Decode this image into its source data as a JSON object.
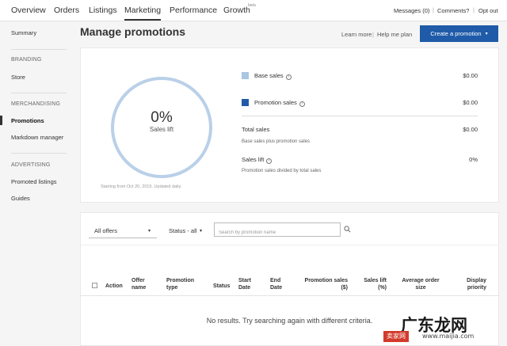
{
  "nav": {
    "tabs": [
      "Overview",
      "Orders",
      "Listings",
      "Marketing",
      "Performance",
      "Growth"
    ],
    "active_tab": "Marketing",
    "growth_badge": "beta",
    "messages": "Messages (0)",
    "comments": "Comments?",
    "opt_out": "Opt out"
  },
  "sidebar": {
    "summary": "Summary",
    "branding_heading": "BRANDING",
    "store": "Store",
    "merchandising_heading": "MERCHANDISING",
    "promotions": "Promotions",
    "markdown_manager": "Markdown manager",
    "advertising_heading": "ADVERTISING",
    "promoted_listings": "Promoted listings",
    "guides": "Guides"
  },
  "header": {
    "title": "Manage promotions",
    "learn_more": "Learn more",
    "help_me_plan": "Help me plan",
    "create_button": "Create a promotion"
  },
  "summary": {
    "ring_value": "0%",
    "ring_label": "Sales lift",
    "starting_note": "Starting from Oct 20, 2015. Updated daily.",
    "base_sales_label": "Base sales",
    "base_sales_value": "$0.00",
    "promotion_sales_label": "Promotion sales",
    "promotion_sales_value": "$0.00",
    "total_sales_label": "Total sales",
    "total_sales_value": "$0.00",
    "total_sales_sub": "Base sales plus promotion sales",
    "sales_lift_label": "Sales lift",
    "sales_lift_value": "0%",
    "sales_lift_sub": "Promotion sales divided by total sales",
    "colors": {
      "base": "#a9c6e2",
      "promotion": "#1f5ba8",
      "ring": "#b9d0e8"
    }
  },
  "filters": {
    "offers_select": "All offers",
    "status_select": "Status - all",
    "search_placeholder": "Search by promotion name"
  },
  "table": {
    "headers": {
      "action": "Action",
      "offer_name": "Offer name",
      "promotion_type": "Promotion type",
      "status": "Status",
      "start_date": "Start Date",
      "end_date": "End Date",
      "promotion_sales": "Promotion sales ($)",
      "sales_lift": "Sales lift (%)",
      "avg_order": "Average order size",
      "display_priority": "Display priority"
    },
    "empty_message": "No results. Try searching again with different criteria."
  },
  "watermark": {
    "brand": "广东龙网",
    "tag": "卖家网",
    "url": "www.maijia.com"
  }
}
